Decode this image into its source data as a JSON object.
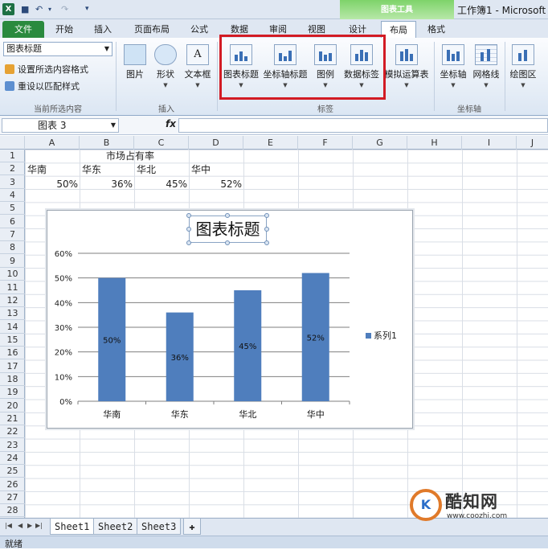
{
  "title_bar": {
    "app_icon_letter": "X",
    "save_glyph": "■",
    "undo_glyph": "↶",
    "redo_glyph": "↷",
    "qat_more_glyph": "▾",
    "context_group": "图表工具",
    "window_title": "工作簿1 - Microsoft"
  },
  "tabs": [
    {
      "label": "文件"
    },
    {
      "label": "开始"
    },
    {
      "label": "插入"
    },
    {
      "label": "页面布局"
    },
    {
      "label": "公式"
    },
    {
      "label": "数据"
    },
    {
      "label": "审阅"
    },
    {
      "label": "视图"
    },
    {
      "label": "设计"
    },
    {
      "label": "布局"
    },
    {
      "label": "格式"
    }
  ],
  "ribbon": {
    "current_selection": {
      "dropdown_value": "图表标题",
      "format_selection": "设置所选内容格式",
      "reset_style": "重设以匹配样式",
      "group_label": "当前所选内容"
    },
    "insert": {
      "picture": "图片",
      "shapes": "形状",
      "textbox": "文本框",
      "group_label": "插入"
    },
    "labels": {
      "chart_title": "图表标题",
      "axis_titles": "坐标轴标题",
      "legend": "图例",
      "data_labels": "数据标签",
      "data_table": "模拟运算表",
      "group_label": "标签"
    },
    "axes": {
      "axes": "坐标轴",
      "gridlines": "网格线",
      "group_label": "坐标轴"
    },
    "background": {
      "plot_area": "绘图区"
    }
  },
  "formula_bar": {
    "name_box": "图表 3",
    "fx_label": "fx",
    "formula": ""
  },
  "columns": [
    "A",
    "B",
    "C",
    "D",
    "E",
    "F",
    "G",
    "H",
    "I",
    "J"
  ],
  "rows": [
    "1",
    "2",
    "3",
    "4",
    "5",
    "6",
    "7",
    "8",
    "9",
    "10",
    "11",
    "12",
    "13",
    "14",
    "15",
    "16",
    "17",
    "18",
    "19",
    "20",
    "21",
    "22",
    "23",
    "24",
    "25",
    "26",
    "27",
    "28"
  ],
  "cells": {
    "title": "市场占有率",
    "regions": [
      "华南",
      "华东",
      "华北",
      "华中"
    ],
    "shares": [
      "50%",
      "36%",
      "45%",
      "52%"
    ]
  },
  "chart_data": {
    "type": "bar",
    "title": "图表标题",
    "categories": [
      "华南",
      "华东",
      "华北",
      "华中"
    ],
    "series": [
      {
        "name": "系列1",
        "values": [
          50,
          36,
          45,
          52
        ],
        "data_labels": [
          "50%",
          "36%",
          "45%",
          "52%"
        ],
        "color": "#4f7ebd"
      }
    ],
    "yticks": [
      "0%",
      "10%",
      "20%",
      "30%",
      "40%",
      "50%",
      "60%"
    ],
    "ylim": [
      0,
      60
    ],
    "grid": true,
    "legend": "right"
  },
  "sheet_tabs": [
    "Sheet1",
    "Sheet2",
    "Sheet3"
  ],
  "status": "就绪",
  "watermark": {
    "logo_letters": "K",
    "name": "酷知网",
    "url": "www.coozhi.com"
  },
  "colors": {
    "accent_green": "#2a8a3e",
    "context_green": "#7ed36a",
    "highlight_red": "#d21b24",
    "bar_blue": "#4f7ebd"
  }
}
